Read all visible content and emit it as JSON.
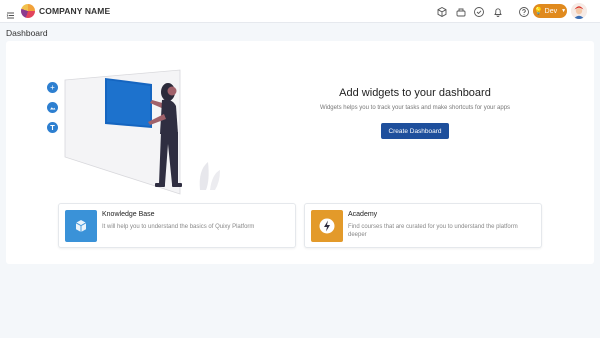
{
  "header": {
    "company_name": "COMPANY NAME",
    "icons": [
      "menu-icon",
      "cube-icon",
      "boxes-icon",
      "check-circle-icon",
      "bell-icon",
      "help-icon"
    ],
    "env_label": "Dev"
  },
  "page": {
    "title": "Dashboard"
  },
  "hero": {
    "title": "Add widgets to your dashboard",
    "subtitle": "Widgets helps you to track your tasks and make shortcuts for your apps",
    "button_label": "Create Dashboard"
  },
  "cards": [
    {
      "title": "Knowledge Base",
      "description": "It will help you to understand the basics of Quixy Platform",
      "icon": "cube-icon",
      "color": "#3a92d8"
    },
    {
      "title": "Academy",
      "description": "Find courses that are curated for you to understand the platform deeper",
      "icon": "lightning-icon",
      "color": "#e39a2a"
    }
  ],
  "colors": {
    "accent": "#1e4f9c",
    "env": "#e08a1e",
    "tool": "#2d7fd0"
  }
}
